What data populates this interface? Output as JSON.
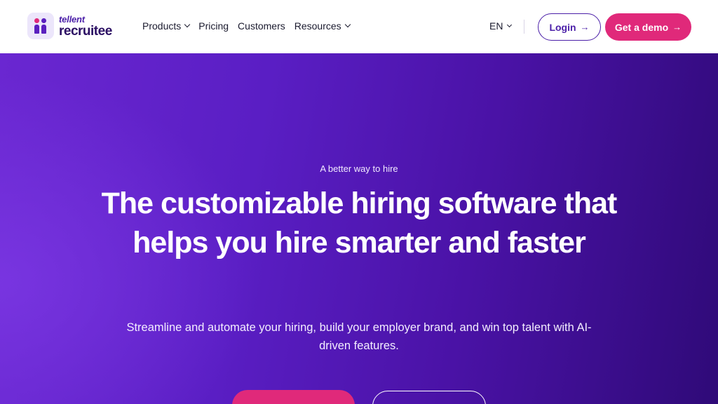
{
  "brand": {
    "top": "tellent",
    "bottom": "recruitee"
  },
  "nav": {
    "items": [
      {
        "label": "Products",
        "has_dropdown": true
      },
      {
        "label": "Pricing",
        "has_dropdown": false
      },
      {
        "label": "Customers",
        "has_dropdown": false
      },
      {
        "label": "Resources",
        "has_dropdown": true
      }
    ],
    "language": "EN"
  },
  "actions": {
    "login_label": "Login",
    "demo_label": "Get a demo",
    "arrow": "→"
  },
  "hero": {
    "eyebrow": "A better way to hire",
    "headline": "The customizable hiring software that helps you hire smarter and faster",
    "subhead": "Streamline and automate your hiring, build your employer brand, and win top talent with AI-driven features."
  },
  "colors": {
    "accent": "#e0297a",
    "brand_purple": "#4b1fa8",
    "hero_start": "#6a27d1",
    "hero_end": "#2f0a78"
  }
}
